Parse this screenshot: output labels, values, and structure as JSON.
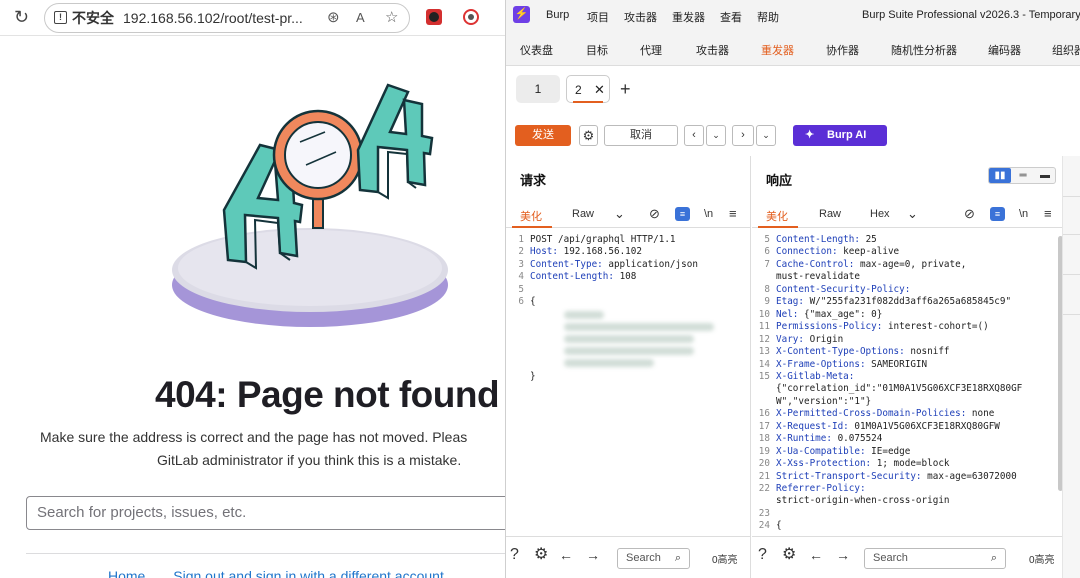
{
  "browser": {
    "insecure_label": "不安全",
    "url": "192.168.56.102/root/test-pr...",
    "page": {
      "title": "404: Page not found",
      "desc_line1": "Make sure the address is correct and the page has not moved. Pleas",
      "desc_line2": "GitLab administrator if you think this is a mistake.",
      "search_placeholder": "Search for projects, issues, etc.",
      "links": [
        "Home",
        "Sign out and sign in with a different account"
      ]
    },
    "illustration_label": "404"
  },
  "burp": {
    "logo": "⚡",
    "menu": [
      "Burp",
      "项目",
      "攻击器",
      "重发器",
      "查看",
      "帮助"
    ],
    "app_title": "Burp Suite Professional v2026.3 - Temporary",
    "tabs": [
      "仪表盘",
      "目标",
      "代理",
      "攻击器",
      "重发器",
      "协作器",
      "随机性分析器",
      "编码器",
      "组织器"
    ],
    "active_tab": "重发器",
    "repeater_tabs": [
      "1",
      "2"
    ],
    "toolbar": {
      "send": "发送",
      "cancel": "取消",
      "burp_ai": "Burp AI"
    },
    "request": {
      "title": "请求",
      "subtabs": [
        "美化",
        "Raw"
      ],
      "lines": [
        {
          "n": "1",
          "k": "",
          "v": "POST /api/graphql HTTP/1.1"
        },
        {
          "n": "2",
          "k": "Host:",
          "v": " 192.168.56.102"
        },
        {
          "n": "3",
          "k": "Content-Type:",
          "v": " application/json"
        },
        {
          "n": "4",
          "k": "Content-Length:",
          "v": " 108"
        },
        {
          "n": "5",
          "k": "",
          "v": ""
        },
        {
          "n": "6",
          "k": "",
          "v": "{"
        },
        {
          "n": "",
          "k": "",
          "v": ""
        },
        {
          "n": "",
          "k": "",
          "v": ""
        },
        {
          "n": "",
          "k": "",
          "v": ""
        },
        {
          "n": "",
          "k": "",
          "v": ""
        },
        {
          "n": "",
          "k": "",
          "v": ""
        },
        {
          "n": "",
          "k": "",
          "v": "}"
        }
      ],
      "search_placeholder": "Search",
      "highlights": "0高亮"
    },
    "response": {
      "title": "响应",
      "subtabs": [
        "美化",
        "Raw",
        "Hex"
      ],
      "lines": [
        {
          "n": "5",
          "k": "Content-Length:",
          "v": " 25"
        },
        {
          "n": "6",
          "k": "Connection:",
          "v": " keep-alive"
        },
        {
          "n": "7",
          "k": "Cache-Control:",
          "v": " max-age=0, private,"
        },
        {
          "n": "",
          "k": "",
          "v": "must-revalidate"
        },
        {
          "n": "8",
          "k": "Content-Security-Policy:",
          "v": ""
        },
        {
          "n": "9",
          "k": "Etag:",
          "v": " W/\"255fa231f082dd3aff6a265a685845c9\""
        },
        {
          "n": "10",
          "k": "Nel:",
          "v": " {\"max_age\": 0}"
        },
        {
          "n": "11",
          "k": "Permissions-Policy:",
          "v": " interest-cohort=()"
        },
        {
          "n": "12",
          "k": "Vary:",
          "v": " Origin"
        },
        {
          "n": "13",
          "k": "X-Content-Type-Options:",
          "v": " nosniff"
        },
        {
          "n": "14",
          "k": "X-Frame-Options:",
          "v": " SAMEORIGIN"
        },
        {
          "n": "15",
          "k": "X-Gitlab-Meta:",
          "v": ""
        },
        {
          "n": "",
          "k": "",
          "v": "{\"correlation_id\":\"01M0A1V5G06XCF3E18RXQ80GF"
        },
        {
          "n": "",
          "k": "",
          "v": "W\",\"version\":\"1\"}"
        },
        {
          "n": "16",
          "k": "X-Permitted-Cross-Domain-Policies:",
          "v": " none"
        },
        {
          "n": "17",
          "k": "X-Request-Id:",
          "v": " 01M0A1V5G06XCF3E18RXQ80GFW"
        },
        {
          "n": "18",
          "k": "X-Runtime:",
          "v": " 0.075524"
        },
        {
          "n": "19",
          "k": "X-Ua-Compatible:",
          "v": " IE=edge"
        },
        {
          "n": "20",
          "k": "X-Xss-Protection:",
          "v": " 1; mode=block"
        },
        {
          "n": "21",
          "k": "Strict-Transport-Security:",
          "v": " max-age=63072000"
        },
        {
          "n": "22",
          "k": "Referrer-Policy:",
          "v": ""
        },
        {
          "n": "",
          "k": "",
          "v": "strict-origin-when-cross-origin"
        },
        {
          "n": "23",
          "k": "",
          "v": ""
        },
        {
          "n": "24",
          "k": "",
          "v": "{"
        }
      ],
      "search_placeholder": "Search",
      "highlights": "0高亮"
    }
  },
  "colors": {
    "accent": "#e35f1f",
    "burp_ai": "#5b2fd6",
    "header_key": "#1e3fb8",
    "link": "#1f75cb"
  }
}
